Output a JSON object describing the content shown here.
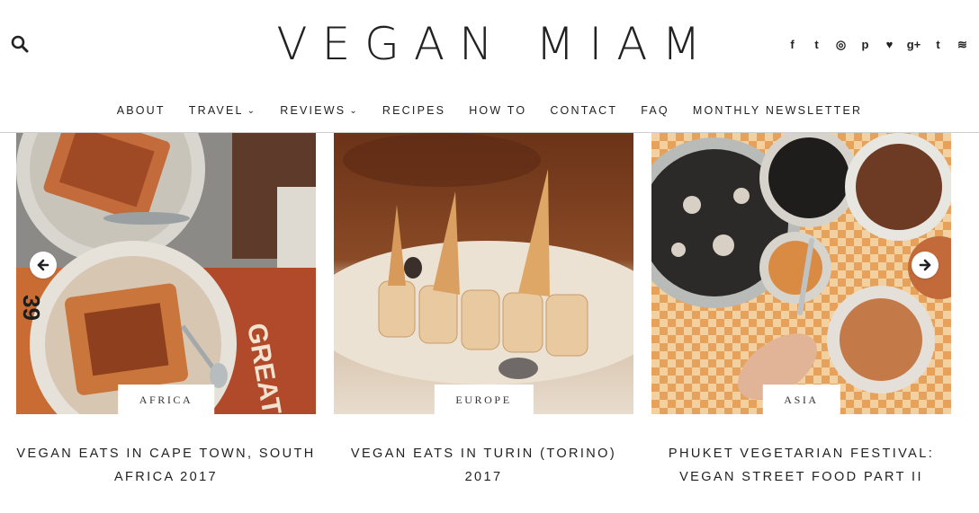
{
  "site": {
    "logo": "VEGAN MIAM"
  },
  "header": {
    "social_icons": [
      "facebook-icon",
      "twitter-icon",
      "instagram-icon",
      "pinterest-icon",
      "heart-icon",
      "google-plus-icon",
      "tumblr-icon",
      "rss-icon"
    ],
    "social_glyphs": [
      "f",
      "t",
      "◎",
      "p",
      "♥",
      "g+",
      "t",
      "≋"
    ]
  },
  "nav": {
    "items": [
      {
        "label": "ABOUT",
        "dropdown": false
      },
      {
        "label": "TRAVEL",
        "dropdown": true
      },
      {
        "label": "REVIEWS",
        "dropdown": true
      },
      {
        "label": "RECIPES",
        "dropdown": false
      },
      {
        "label": "HOW TO",
        "dropdown": false
      },
      {
        "label": "CONTACT",
        "dropdown": false
      },
      {
        "label": "FAQ",
        "dropdown": false
      },
      {
        "label": "MONTHLY NEWSLETTER",
        "dropdown": false
      }
    ]
  },
  "posts": [
    {
      "category": "AFRICA",
      "title": "VEGAN EATS IN CAPE TOWN, SOUTH AFRICA 2017"
    },
    {
      "category": "EUROPE",
      "title": "VEGAN EATS IN TURIN (TORINO) 2017"
    },
    {
      "category": "ASIA",
      "title": "PHUKET VEGETARIAN FESTIVAL: VEGAN STREET FOOD PART II"
    }
  ],
  "colors": {
    "text": "#222222",
    "divider": "#cfcfcf",
    "background": "#ffffff"
  }
}
